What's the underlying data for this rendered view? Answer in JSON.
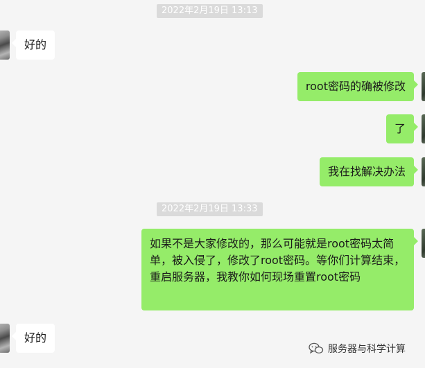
{
  "chat": {
    "timestamps": [
      "2022年2月19日 13:13",
      "2022年2月19日 13:33"
    ],
    "messages": [
      {
        "side": "in",
        "text": "好的"
      },
      {
        "side": "out",
        "text": "root密码的确被修改"
      },
      {
        "side": "out",
        "text": "了"
      },
      {
        "side": "out",
        "text": "我在找解决办法"
      },
      {
        "side": "out",
        "text": "如果不是大家修改的，那么可能就是root密码太简单，被入侵了，修改了root密码。等你们计算结束，重启服务器，我教你如何现场重置root密码"
      },
      {
        "side": "in",
        "text": "好的"
      }
    ]
  },
  "watermark": {
    "icon": "wechat-official-account-icon",
    "text": "服务器与科学计算"
  },
  "colors": {
    "background": "#f5f5f5",
    "outgoing_bubble": "#95ec69",
    "incoming_bubble": "#ffffff",
    "timestamp_bg": "#dadada"
  }
}
